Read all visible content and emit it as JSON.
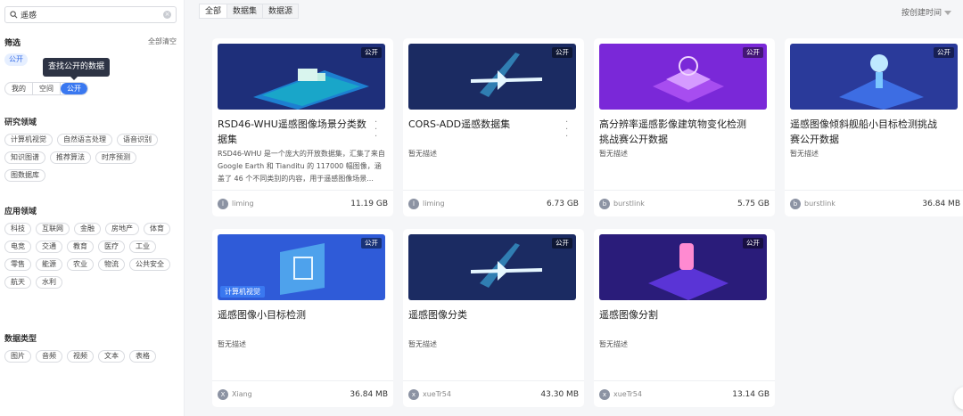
{
  "search": {
    "value": "遥感"
  },
  "filter": {
    "title": "筛选",
    "clear_all": "全部清空",
    "selected_tag": "公开"
  },
  "tooltip": "查找公开的数据",
  "visibility_seg": [
    "我的",
    "空间",
    "公开"
  ],
  "research": {
    "title": "研究领域",
    "items": [
      "计算机视觉",
      "自然语言处理",
      "语音识别",
      "知识图谱",
      "推荐算法",
      "时序预测",
      "图数据库"
    ]
  },
  "application": {
    "title": "应用领域",
    "items": [
      "科技",
      "互联网",
      "金融",
      "房地产",
      "体育",
      "电竞",
      "交通",
      "教育",
      "医疗",
      "工业",
      "零售",
      "能源",
      "农业",
      "物流",
      "公共安全",
      "航天",
      "水利"
    ]
  },
  "datatype": {
    "title": "数据类型",
    "items": [
      "图片",
      "音频",
      "视频",
      "文本",
      "表格"
    ]
  },
  "tabs": [
    "全部",
    "数据集",
    "数据源"
  ],
  "sort": {
    "label": "按创建时间"
  },
  "cards": [
    {
      "title": "RSD46-WHU遥感图像场景分类数据集",
      "badge": "公开",
      "desc": "RSD46-WHU 是一个庞大的开放数据集，汇集了来自 Google Earth 和 Tianditu 的 117000 幅图像，涵盖了 46 个不同类别的内容，用于遥感图像场景...",
      "avatar": "l",
      "user": "liming",
      "size": "11.19 GB",
      "has_menu": true
    },
    {
      "title": "CORS-ADD遥感数据集",
      "badge": "公开",
      "desc": "暂无描述",
      "avatar": "l",
      "user": "liming",
      "size": "6.73 GB",
      "has_menu": true
    },
    {
      "title": "高分辨率遥感影像建筑物变化检测挑战赛公开数据",
      "badge": "公开",
      "desc": "暂无描述",
      "avatar": "b",
      "user": "burstlink",
      "size": "5.75 GB"
    },
    {
      "title": "遥感图像倾斜舰船小目标检测挑战赛公开数据",
      "badge": "公开",
      "desc": "暂无描述",
      "avatar": "b",
      "user": "burstlink",
      "size": "36.84 MB"
    },
    {
      "title": "遥感图像小目标检测",
      "badge": "公开",
      "category": "计算机视觉",
      "desc": "暂无描述",
      "avatar": "X",
      "user": "Xiang",
      "size": "36.84 MB"
    },
    {
      "title": "遥感图像分类",
      "badge": "公开",
      "desc": "暂无描述",
      "avatar": "x",
      "user": "xueTr54",
      "size": "43.30 MB"
    },
    {
      "title": "遥感图像分割",
      "badge": "公开",
      "desc": "暂无描述",
      "avatar": "x",
      "user": "xueTr54",
      "size": "13.14 GB"
    }
  ]
}
